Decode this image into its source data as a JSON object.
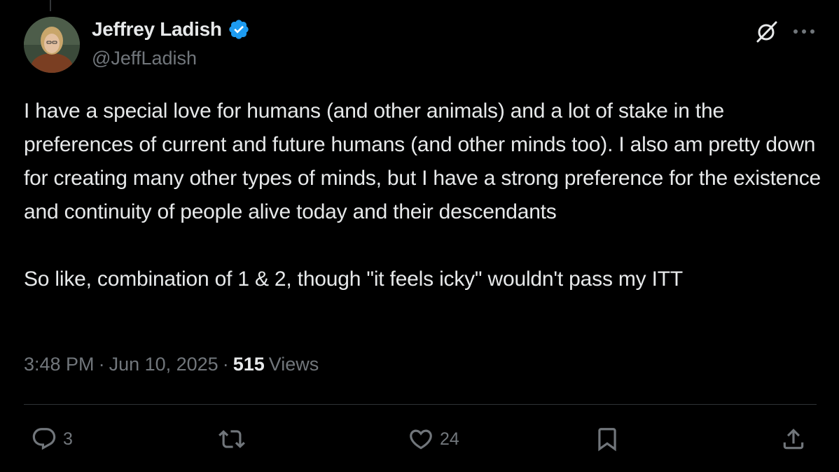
{
  "author": {
    "name": "Jeffrey Ladish",
    "handle": "@JeffLadish",
    "verified": true
  },
  "tweet": {
    "text": "I have a special love for humans (and other animals) and a lot of stake in the preferences of current and future humans (and other minds too). I also am pretty down for creating many other types of minds, but I have a strong preference for the existence and continuity of people alive today and their descendants\n\nSo like, combination of 1 & 2, though \"it feels icky\" wouldn't pass my ITT"
  },
  "meta": {
    "time": "3:48 PM",
    "separator1": "·",
    "date": "Jun 10, 2025",
    "separator2": "·",
    "views_count": "515",
    "views_label": "Views"
  },
  "actions": {
    "reply_count": "3",
    "retweet_count": "",
    "like_count": "24"
  },
  "colors": {
    "background": "#000000",
    "text_primary": "#e7e9ea",
    "text_secondary": "#71767b",
    "verified_badge": "#1d9bf0",
    "divider": "#2f3336"
  },
  "icons": {
    "verified": "verified-badge-icon",
    "grok": "grok-icon",
    "more": "more-dots-icon",
    "reply": "reply-icon",
    "retweet": "retweet-icon",
    "like": "heart-icon",
    "bookmark": "bookmark-icon",
    "share": "share-icon"
  }
}
